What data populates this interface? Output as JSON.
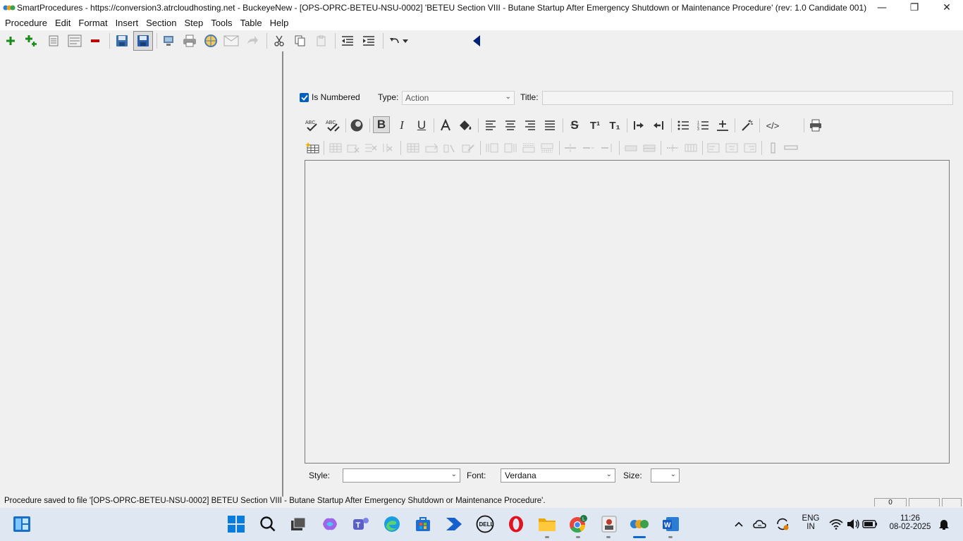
{
  "window": {
    "title": "SmartProcedures - https://conversion3.atrcloudhosting.net - BuckeyeNew - [OPS-OPRC-BETEU-NSU-0002] 'BETEU Section VIII - Butane Startup After Emergency Shutdown or Maintenance Procedure' (rev: 1.0 Candidate 001)",
    "minimize": "—",
    "restore": "❐",
    "close": "✕"
  },
  "menu": [
    "Procedure",
    "Edit",
    "Format",
    "Insert",
    "Section",
    "Step",
    "Tools",
    "Table",
    "Help"
  ],
  "step_header": {
    "is_numbered_label": "Is Numbered",
    "is_numbered_checked": true,
    "type_label": "Type:",
    "type_value": "Action",
    "title_label": "Title:",
    "title_value": ""
  },
  "editor_format": {
    "bold": "B",
    "italic": "I",
    "underline": "U",
    "strike": "S",
    "superscript": "T¹",
    "subscript": "T₁",
    "code": "</>"
  },
  "style_bar": {
    "style_label": "Style:",
    "style_value": "",
    "font_label": "Font:",
    "font_value": "Verdana",
    "size_label": "Size:",
    "size_value": ""
  },
  "status": {
    "message": "Procedure saved to file '[OPS-OPRC-BETEU-NSU-0002] BETEU Section VIII - Butane Startup After Emergency Shutdown or Maintenance Procedure'.",
    "box1": "0",
    "box2": "",
    "box3": ""
  },
  "tray": {
    "lang_top": "ENG",
    "lang_bottom": "IN",
    "time": "11:26",
    "date": "08-02-2025"
  },
  "colors": {
    "accent": "#0060c0",
    "add_green": "#1a8a1a",
    "remove_red": "#c00000",
    "nav_arrow": "#00207a"
  }
}
